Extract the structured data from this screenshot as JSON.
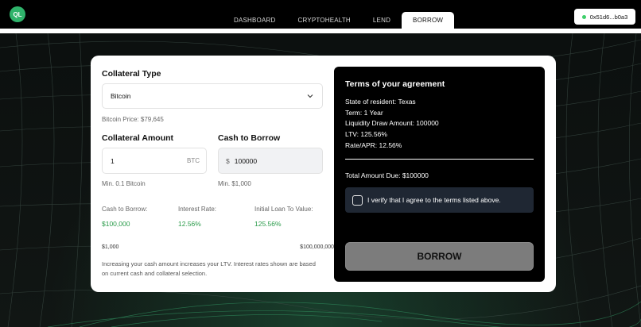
{
  "header": {
    "logo_text": "QL",
    "nav": [
      {
        "label": "DASHBOARD",
        "active": false
      },
      {
        "label": "CRYPTOHEALTH",
        "active": false
      },
      {
        "label": "LEND",
        "active": false
      },
      {
        "label": "BORROW",
        "active": true
      }
    ],
    "wallet_address": "0x51d6...b0a3",
    "wallet_status_color": "#3ecf6b"
  },
  "form": {
    "collateral_type_label": "Collateral Type",
    "collateral_type_value": "Bitcoin",
    "collateral_price": "Bitcoin Price: $79,645",
    "collateral_amount_label": "Collateral Amount",
    "collateral_amount_value": "1",
    "collateral_amount_unit": "BTC",
    "collateral_amount_min": "Min. 0.1 Bitcoin",
    "cash_label": "Cash to Borrow",
    "cash_currency": "$",
    "cash_value": "100000",
    "cash_min": "Min. $1,000",
    "stats": [
      {
        "label": "Cash to Borrow:",
        "value": "$100,000"
      },
      {
        "label": "Interest Rate:",
        "value": "12.56%"
      },
      {
        "label": "Initial Loan To Value:",
        "value": "125.56%"
      }
    ],
    "range_min": "$1,000",
    "range_max": "$100,000,000",
    "note": "Increasing your cash amount increases your LTV. Interest rates shown are based on current cash and collateral selection."
  },
  "terms": {
    "title": "Terms of your agreement",
    "lines": [
      "State of resident: Texas",
      "Term: 1 Year",
      "Liquidity Draw Amount: 100000",
      "LTV: 125.56%",
      "Rate/APR: 12.56%"
    ],
    "total": "Total Amount Due: $100000",
    "verify_label": "I verify that I agree to the terms listed above.",
    "borrow_label": "BORROW"
  },
  "colors": {
    "accent_green": "#2a9b4a",
    "panel_bg": "#000000",
    "button_disabled": "#7c7c7c"
  }
}
